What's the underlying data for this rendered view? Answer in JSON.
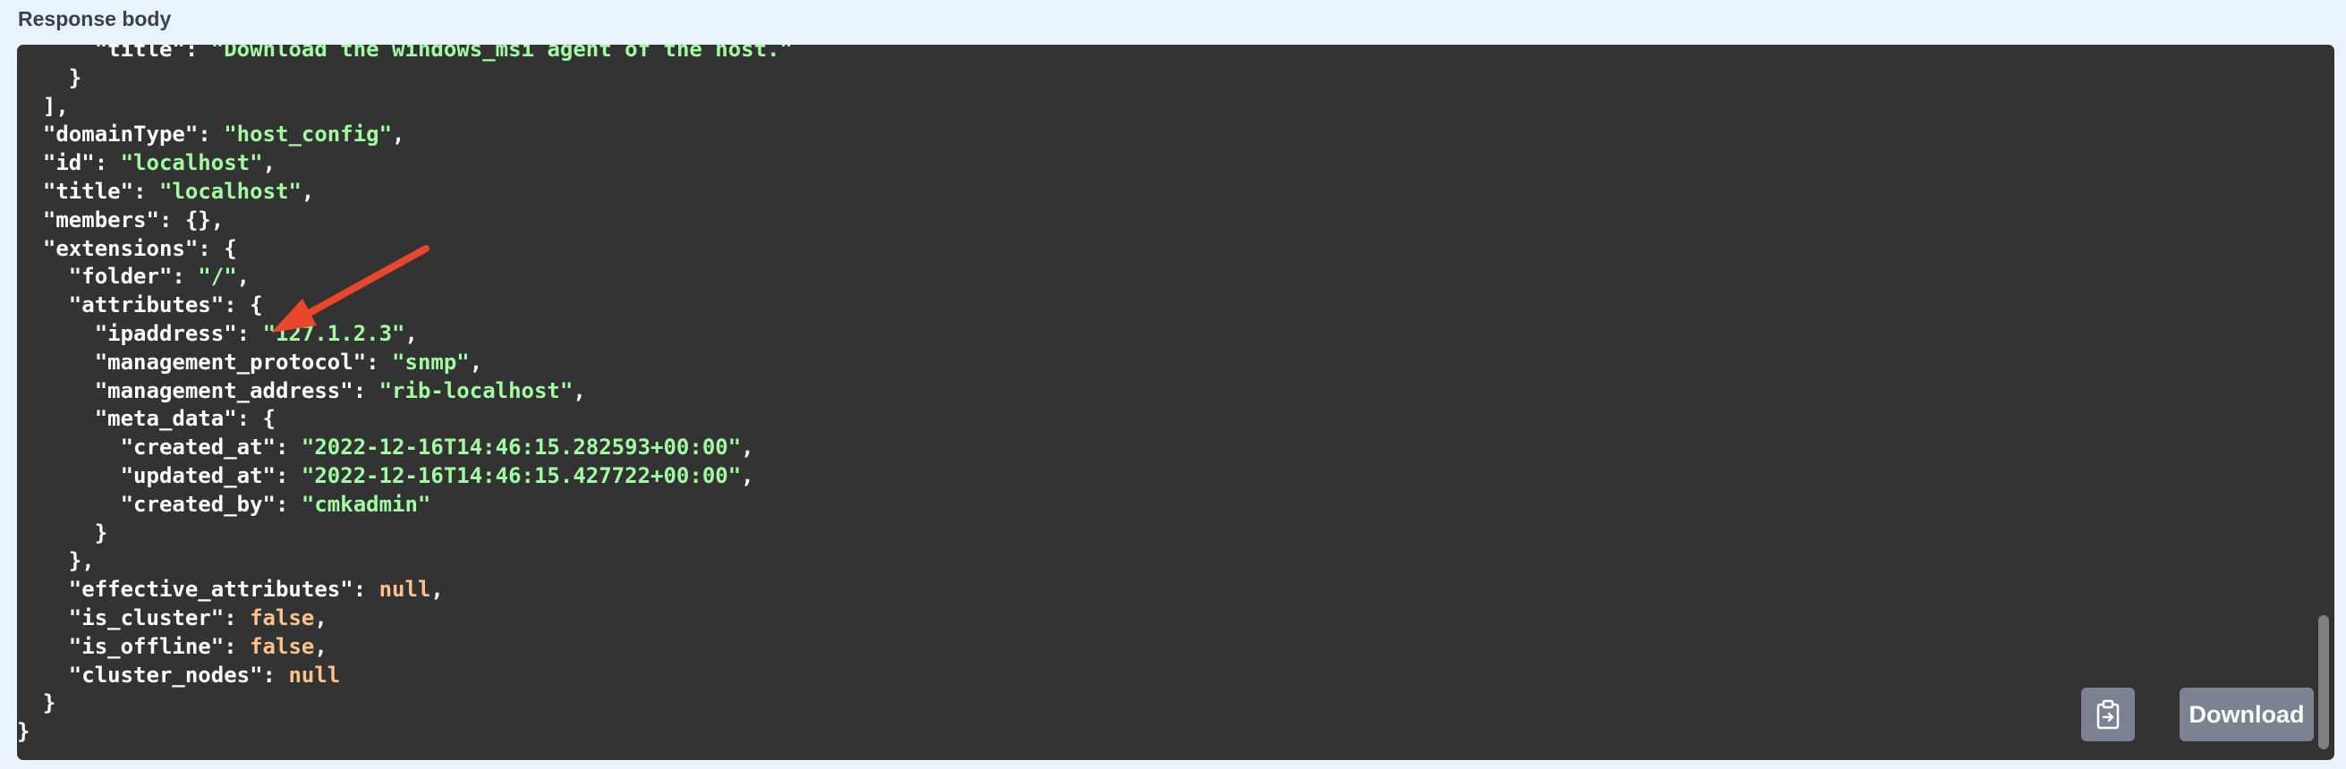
{
  "section": {
    "label": "Response body"
  },
  "response": {
    "lines": [
      [
        {
          "t": "      ",
          "c": "p"
        },
        {
          "t": "\"title\"",
          "c": "k"
        },
        {
          "t": ": ",
          "c": "p"
        },
        {
          "t": "\"Download the windows_msi agent of the host.\"",
          "c": "s"
        }
      ],
      [
        {
          "t": "    }",
          "c": "p"
        }
      ],
      [
        {
          "t": "  ],",
          "c": "p"
        }
      ],
      [
        {
          "t": "  ",
          "c": "p"
        },
        {
          "t": "\"domainType\"",
          "c": "k"
        },
        {
          "t": ": ",
          "c": "p"
        },
        {
          "t": "\"host_config\"",
          "c": "s"
        },
        {
          "t": ",",
          "c": "p"
        }
      ],
      [
        {
          "t": "  ",
          "c": "p"
        },
        {
          "t": "\"id\"",
          "c": "k"
        },
        {
          "t": ": ",
          "c": "p"
        },
        {
          "t": "\"localhost\"",
          "c": "s"
        },
        {
          "t": ",",
          "c": "p"
        }
      ],
      [
        {
          "t": "  ",
          "c": "p"
        },
        {
          "t": "\"title\"",
          "c": "k"
        },
        {
          "t": ": ",
          "c": "p"
        },
        {
          "t": "\"localhost\"",
          "c": "s"
        },
        {
          "t": ",",
          "c": "p"
        }
      ],
      [
        {
          "t": "  ",
          "c": "p"
        },
        {
          "t": "\"members\"",
          "c": "k"
        },
        {
          "t": ": {},",
          "c": "p"
        }
      ],
      [
        {
          "t": "  ",
          "c": "p"
        },
        {
          "t": "\"extensions\"",
          "c": "k"
        },
        {
          "t": ": {",
          "c": "p"
        }
      ],
      [
        {
          "t": "    ",
          "c": "p"
        },
        {
          "t": "\"folder\"",
          "c": "k"
        },
        {
          "t": ": ",
          "c": "p"
        },
        {
          "t": "\"/\"",
          "c": "s"
        },
        {
          "t": ",",
          "c": "p"
        }
      ],
      [
        {
          "t": "    ",
          "c": "p"
        },
        {
          "t": "\"attributes\"",
          "c": "k"
        },
        {
          "t": ": {",
          "c": "p"
        }
      ],
      [
        {
          "t": "      ",
          "c": "p"
        },
        {
          "t": "\"ipaddress\"",
          "c": "k"
        },
        {
          "t": ": ",
          "c": "p"
        },
        {
          "t": "\"127.1.2.3\"",
          "c": "s"
        },
        {
          "t": ",",
          "c": "p"
        }
      ],
      [
        {
          "t": "      ",
          "c": "p"
        },
        {
          "t": "\"management_protocol\"",
          "c": "k"
        },
        {
          "t": ": ",
          "c": "p"
        },
        {
          "t": "\"snmp\"",
          "c": "s"
        },
        {
          "t": ",",
          "c": "p"
        }
      ],
      [
        {
          "t": "      ",
          "c": "p"
        },
        {
          "t": "\"management_address\"",
          "c": "k"
        },
        {
          "t": ": ",
          "c": "p"
        },
        {
          "t": "\"rib-localhost\"",
          "c": "s"
        },
        {
          "t": ",",
          "c": "p"
        }
      ],
      [
        {
          "t": "      ",
          "c": "p"
        },
        {
          "t": "\"meta_data\"",
          "c": "k"
        },
        {
          "t": ": {",
          "c": "p"
        }
      ],
      [
        {
          "t": "        ",
          "c": "p"
        },
        {
          "t": "\"created_at\"",
          "c": "k"
        },
        {
          "t": ": ",
          "c": "p"
        },
        {
          "t": "\"2022-12-16T14:46:15.282593+00:00\"",
          "c": "s"
        },
        {
          "t": ",",
          "c": "p"
        }
      ],
      [
        {
          "t": "        ",
          "c": "p"
        },
        {
          "t": "\"updated_at\"",
          "c": "k"
        },
        {
          "t": ": ",
          "c": "p"
        },
        {
          "t": "\"2022-12-16T14:46:15.427722+00:00\"",
          "c": "s"
        },
        {
          "t": ",",
          "c": "p"
        }
      ],
      [
        {
          "t": "        ",
          "c": "p"
        },
        {
          "t": "\"created_by\"",
          "c": "k"
        },
        {
          "t": ": ",
          "c": "p"
        },
        {
          "t": "\"cmkadmin\"",
          "c": "s"
        }
      ],
      [
        {
          "t": "      }",
          "c": "p"
        }
      ],
      [
        {
          "t": "    },",
          "c": "p"
        }
      ],
      [
        {
          "t": "    ",
          "c": "p"
        },
        {
          "t": "\"effective_attributes\"",
          "c": "k"
        },
        {
          "t": ": ",
          "c": "p"
        },
        {
          "t": "null",
          "c": "n"
        },
        {
          "t": ",",
          "c": "p"
        }
      ],
      [
        {
          "t": "    ",
          "c": "p"
        },
        {
          "t": "\"is_cluster\"",
          "c": "k"
        },
        {
          "t": ": ",
          "c": "p"
        },
        {
          "t": "false",
          "c": "n"
        },
        {
          "t": ",",
          "c": "p"
        }
      ],
      [
        {
          "t": "    ",
          "c": "p"
        },
        {
          "t": "\"is_offline\"",
          "c": "k"
        },
        {
          "t": ": ",
          "c": "p"
        },
        {
          "t": "false",
          "c": "n"
        },
        {
          "t": ",",
          "c": "p"
        }
      ],
      [
        {
          "t": "    ",
          "c": "p"
        },
        {
          "t": "\"cluster_nodes\"",
          "c": "k"
        },
        {
          "t": ": ",
          "c": "p"
        },
        {
          "t": "null",
          "c": "n"
        }
      ],
      [
        {
          "t": "  }",
          "c": "p"
        }
      ],
      [
        {
          "t": "}",
          "c": "p"
        }
      ]
    ]
  },
  "actions": {
    "copy_icon": "clipboard-icon",
    "download_label": "Download"
  },
  "annotation": {
    "icon": "arrow-annotation-icon",
    "color": "#e8472b"
  },
  "colors": {
    "panel_bg": "#333333",
    "string": "#a2fca2",
    "literal": "#fcc28c",
    "key": "#ffffff",
    "button_bg": "#7d8293",
    "page_bg": "#eaf2fb"
  }
}
